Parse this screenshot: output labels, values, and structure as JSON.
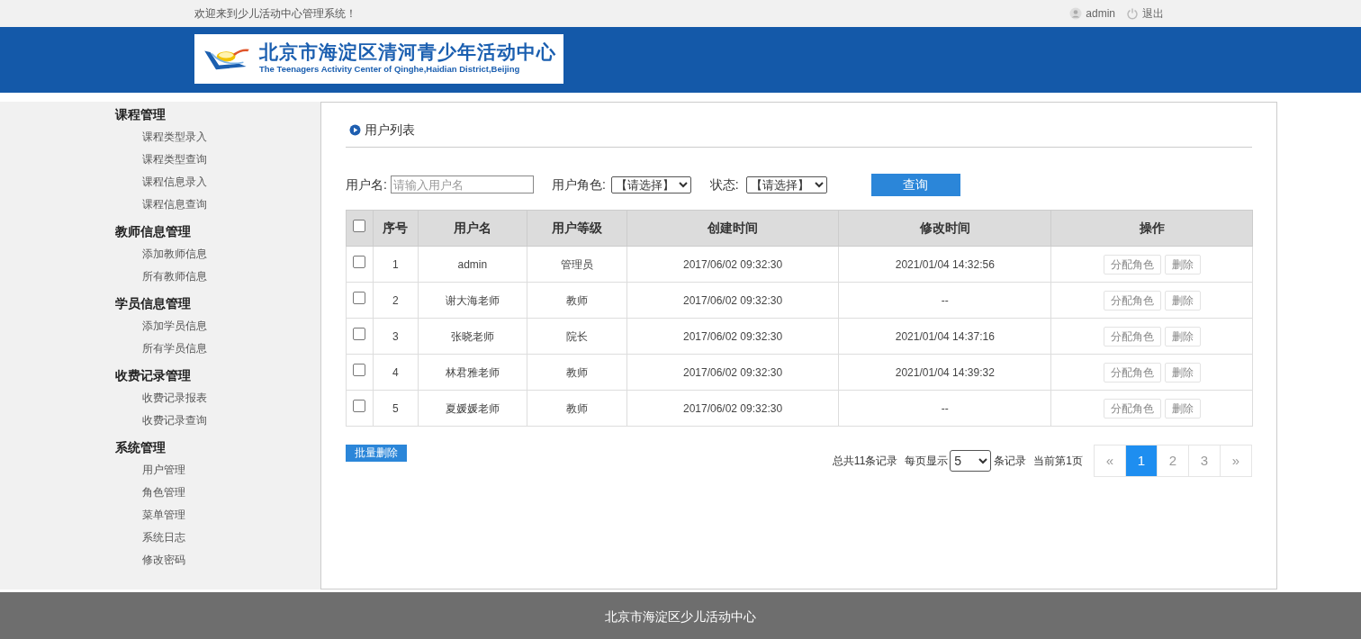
{
  "top_bar": {
    "welcome": "欢迎来到少儿活动中心管理系统！",
    "user": "admin",
    "logout": "退出"
  },
  "logo": {
    "title": "北京市海淀区清河青少年活动中心",
    "subtitle": "The Teenagers Activity Center of Qinghe,Haidian District,Beijing"
  },
  "sidebar": [
    {
      "title": "课程管理",
      "items": [
        "课程类型录入",
        "课程类型查询",
        "课程信息录入",
        "课程信息查询"
      ]
    },
    {
      "title": "教师信息管理",
      "items": [
        "添加教师信息",
        "所有教师信息"
      ]
    },
    {
      "title": "学员信息管理",
      "items": [
        "添加学员信息",
        "所有学员信息"
      ]
    },
    {
      "title": "收费记录管理",
      "items": [
        "收费记录报表",
        "收费记录查询"
      ]
    },
    {
      "title": "系统管理",
      "items": [
        "用户管理",
        "角色管理",
        "菜单管理",
        "系统日志",
        "修改密码"
      ]
    }
  ],
  "panel_title": "用户列表",
  "filters": {
    "username_label": "用户名:",
    "username_placeholder": "请输入用户名",
    "role_label": "用户角色:",
    "role_value": "【请选择】",
    "status_label": "状态:",
    "status_value": "【请选择】",
    "query_button": "查询"
  },
  "table": {
    "select_all": {
      "checked": false
    },
    "columns": [
      "序号",
      "用户名",
      "用户等级",
      "创建时间",
      "修改时间",
      "操作"
    ],
    "rows": [
      {
        "checked": false,
        "cells": [
          "1",
          "admin",
          "管理员",
          "2017/06/02 09:32:30",
          "2021/01/04 14:32:56"
        ],
        "actions": [
          "分配角色",
          "删除"
        ]
      },
      {
        "checked": false,
        "cells": [
          "2",
          "谢大海老师",
          "教师",
          "2017/06/02 09:32:30",
          "--"
        ],
        "actions": [
          "分配角色",
          "删除"
        ]
      },
      {
        "checked": false,
        "cells": [
          "3",
          "张晓老师",
          "院长",
          "2017/06/02 09:32:30",
          "2021/01/04 14:37:16"
        ],
        "actions": [
          "分配角色",
          "删除"
        ]
      },
      {
        "checked": false,
        "cells": [
          "4",
          "林君雅老师",
          "教师",
          "2017/06/02 09:32:30",
          "2021/01/04 14:39:32"
        ],
        "actions": [
          "分配角色",
          "删除"
        ]
      },
      {
        "checked": false,
        "cells": [
          "5",
          "夏媛媛老师",
          "教师",
          "2017/06/02 09:32:30",
          "--"
        ],
        "actions": [
          "分配角色",
          "删除"
        ]
      }
    ]
  },
  "batch_delete": "批量删除",
  "pagination": {
    "total": "总共11条记录",
    "per_page_label": "每页显示",
    "per_page_value": "5",
    "per_page_unit": "条记录",
    "current": "当前第1页",
    "pages": [
      {
        "label": "«",
        "selected": false
      },
      {
        "label": "1",
        "selected": true
      },
      {
        "label": "2",
        "selected": false
      },
      {
        "label": "3",
        "selected": false
      },
      {
        "label": "»",
        "selected": false
      }
    ]
  },
  "footer": "北京市海淀区少儿活动中心"
}
